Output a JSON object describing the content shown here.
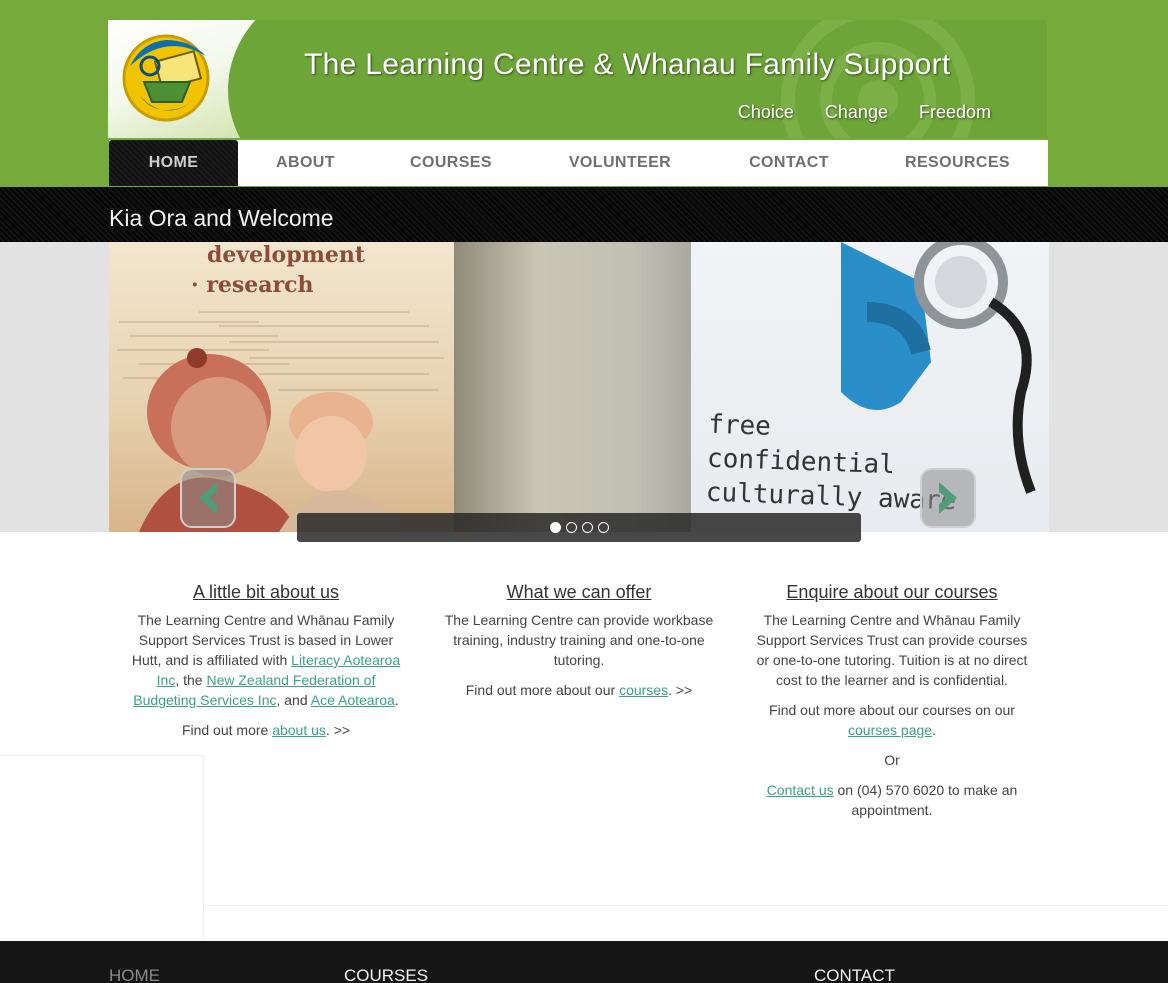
{
  "site": {
    "title": "The Learning Centre & Whanau Family Support",
    "tagline": [
      "Choice",
      "Change",
      "Freedom"
    ]
  },
  "nav": {
    "items": [
      "HOME",
      "ABOUT",
      "COURSES",
      "VOLUNTEER",
      "CONTACT",
      "RESOURCES"
    ],
    "active": "HOME"
  },
  "welcome": {
    "title": "Kia Ora and Welcome"
  },
  "slider": {
    "poster_left": [
      "development",
      "· research"
    ],
    "poster_right": [
      "free",
      "confidential",
      "culturally aware"
    ],
    "dot_count": 4,
    "active_dot": 1,
    "icons": {
      "prev": "chevron-left-icon",
      "next": "chevron-right-icon"
    }
  },
  "columns": {
    "about": {
      "heading": "A little bit about us",
      "p1_text1": "The Learning Centre and Whānau Family Support Services Trust is based in Lower Hutt, and is affiliated with ",
      "link_literacy": "Literacy Aotearoa Inc",
      "p1_text2": ", the ",
      "link_budgeting": "New Zealand Federation of Budgeting Services Inc",
      "p1_text3": ", and ",
      "link_ace": "Ace Aotearoa",
      "p1_text4": ".",
      "p2_text1": "Find out more ",
      "link_about": "about us",
      "p2_text2": ". >>"
    },
    "offer": {
      "heading": "What we can offer",
      "p1": "The Learning Centre can provide workbase training, industry training and one-to-one tutoring.",
      "p2_text1": "Find out more about our ",
      "link_courses": "courses",
      "p2_text2": ". >>"
    },
    "enquire": {
      "heading": "Enquire about our courses",
      "p1": "The Learning Centre and Whānau Family Support Services Trust can provide courses or one-to-one tutoring. Tuition is at no direct cost to the learner and is confidential.",
      "p2_text1": "Find out more about our courses on our ",
      "link_courses_page": "courses page",
      "p2_text2": ".",
      "p3": "Or",
      "link_contact": "Contact us",
      "p4_text": " on (04) 570 6020 to make an appointment."
    }
  },
  "footer": {
    "home": "HOME",
    "courses": "COURSES",
    "contact": "CONTACT"
  },
  "colors": {
    "brand_green": "#75ab3b",
    "link_green": "#3aa380",
    "dark": "#151515"
  }
}
